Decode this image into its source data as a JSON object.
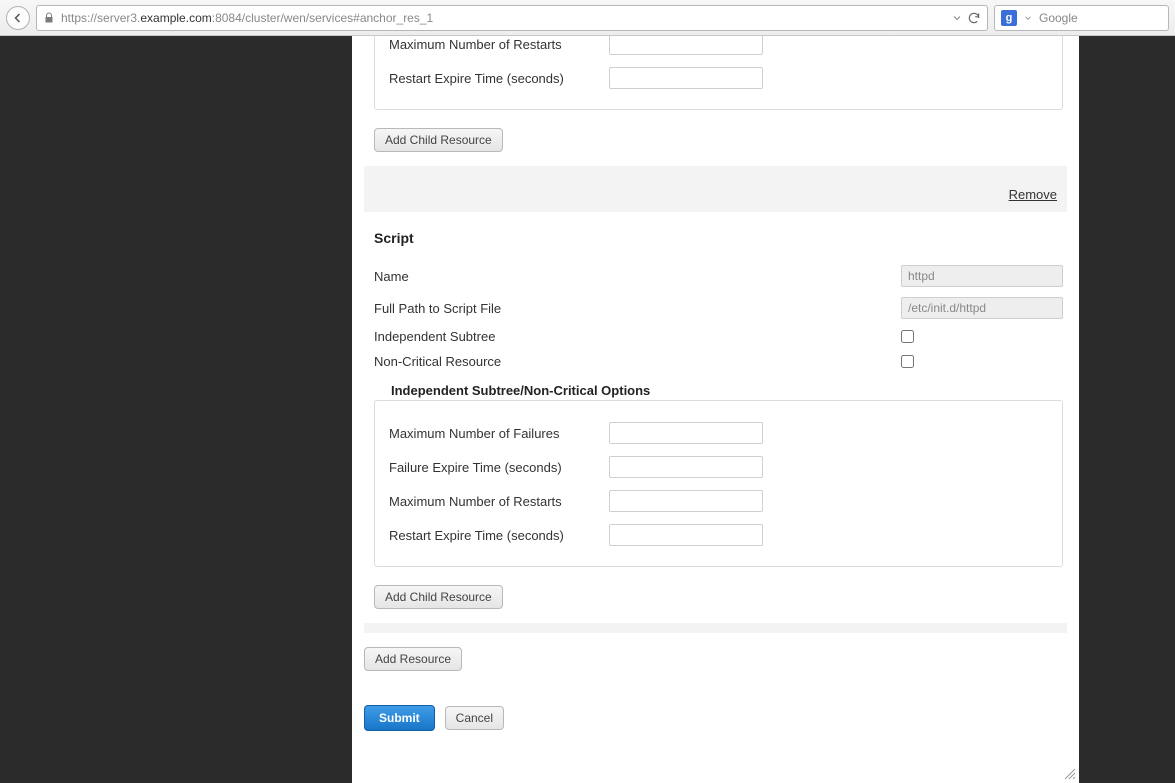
{
  "browser": {
    "url_prefix": "https://server3.",
    "url_host": "example.com",
    "url_suffix": ":8084/cluster/wen/services#anchor_res_1",
    "search_placeholder": "Google"
  },
  "resource1": {
    "options": {
      "max_restarts": {
        "label": "Maximum Number of Restarts",
        "value": ""
      },
      "restart_expire": {
        "label": "Restart Expire Time (seconds)",
        "value": ""
      }
    },
    "add_child_button": "Add Child Resource"
  },
  "script_section": {
    "remove_link": "Remove",
    "title": "Script",
    "fields": {
      "name": {
        "label": "Name",
        "value": "httpd"
      },
      "path": {
        "label": "Full Path to Script File",
        "value": "/etc/init.d/httpd"
      },
      "independent_subtree": {
        "label": "Independent Subtree",
        "checked": false
      },
      "non_critical": {
        "label": "Non-Critical Resource",
        "checked": false
      }
    },
    "subtree_legend": "Independent Subtree/Non-Critical Options",
    "subtree_options": {
      "max_failures": {
        "label": "Maximum Number of Failures",
        "value": ""
      },
      "failure_expire": {
        "label": "Failure Expire Time (seconds)",
        "value": ""
      },
      "max_restarts": {
        "label": "Maximum Number of Restarts",
        "value": ""
      },
      "restart_expire": {
        "label": "Restart Expire Time (seconds)",
        "value": ""
      }
    },
    "add_child_button": "Add Child Resource"
  },
  "footer": {
    "add_resource": "Add Resource",
    "submit": "Submit",
    "cancel": "Cancel"
  }
}
